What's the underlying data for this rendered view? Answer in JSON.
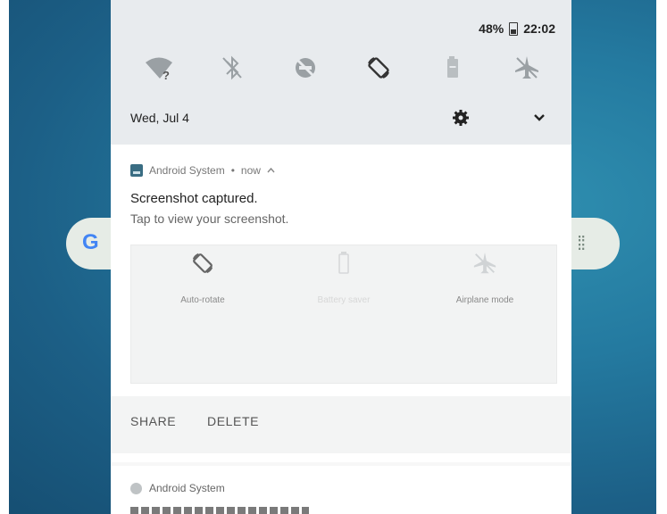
{
  "status_bar": {
    "battery": "48%",
    "time": "22:02"
  },
  "quick_settings": {
    "tiles": [
      {
        "icon": "wifi-unknown-icon"
      },
      {
        "icon": "bluetooth-off-icon"
      },
      {
        "icon": "do-not-disturb-off-icon"
      },
      {
        "icon": "auto-rotate-icon"
      },
      {
        "icon": "battery-saver-icon"
      },
      {
        "icon": "airplane-mode-icon"
      }
    ],
    "date": "Wed, Jul 4"
  },
  "notification": {
    "app_name": "Android System",
    "separator": "•",
    "time": "now",
    "title": "Screenshot captured.",
    "text": "Tap to view your screenshot.",
    "preview": {
      "tiles": [
        {
          "icon": "auto-rotate-icon",
          "label": "Auto-rotate"
        },
        {
          "icon": "battery-saver-icon",
          "label": "Battery saver"
        },
        {
          "icon": "airplane-mode-icon",
          "label": "Airplane mode"
        }
      ]
    },
    "actions": {
      "share": "SHARE",
      "delete": "DELETE"
    }
  },
  "next_notification": {
    "app_name": "Android System"
  },
  "colors": {
    "accent": "#3a6d83",
    "wallpaper": "#247aa0",
    "quick_settings_bg": "#e8ebee"
  }
}
